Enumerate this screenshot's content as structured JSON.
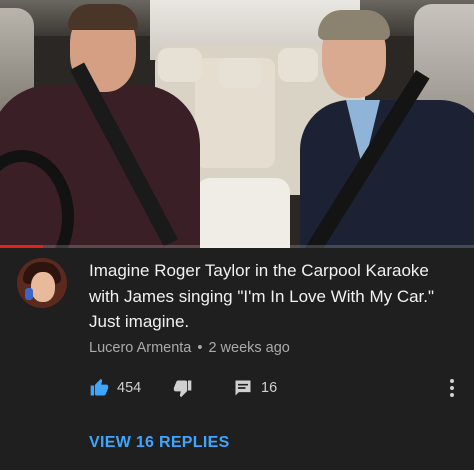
{
  "video": {
    "progress_fraction": 0.09,
    "progress_color": "#e62117"
  },
  "comment": {
    "avatar_icon": "user-avatar",
    "text_lines": [
      "Imagine Roger Taylor in the Carpool Karaoke",
      "with James singing \"I'm In Love With My Car.\"",
      "Just imagine."
    ],
    "author": "Lucero Armenta",
    "separator": "•",
    "time": "2 weeks ago",
    "likes": "454",
    "replies_count": "16",
    "like_icon": "thumbs-up-icon",
    "like_icon_color": "#3ea6ff",
    "dislike_icon": "thumbs-down-icon",
    "reply_icon": "comment-icon",
    "more_icon": "more-vertical-icon"
  },
  "view_replies": {
    "label": "VIEW 16 REPLIES",
    "color": "#3ea6ff"
  }
}
